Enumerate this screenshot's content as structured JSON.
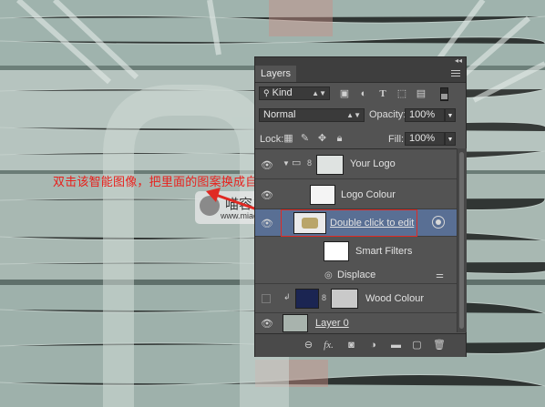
{
  "annotation": "双击该智能图像，把里面的图案换成自己的图案，保存后关闭。",
  "watermark": {
    "name": "喵容",
    "url": "www.miaorong.com"
  },
  "panel": {
    "tab_label": "Layers",
    "filter_kind": "Kind",
    "blend_mode": "Normal",
    "opacity_label": "Opacity:",
    "opacity_value": "100%",
    "lock_label": "Lock:",
    "fill_label": "Fill:",
    "fill_value": "100%",
    "filter_icons": [
      "image-icon",
      "adjustment-icon",
      "text-icon",
      "shape-icon",
      "smart-object-icon"
    ],
    "lock_icons": [
      "lock-pixels-icon",
      "lock-paint-icon",
      "lock-position-icon",
      "lock-all-icon"
    ],
    "layers": [
      {
        "name": "Your Logo",
        "type": "group"
      },
      {
        "name": "Logo Colour",
        "type": "layer"
      },
      {
        "name": "Double click to edit",
        "type": "smart-object",
        "selected": true
      },
      {
        "name": "Smart Filters",
        "type": "smart-filters"
      },
      {
        "name": "Displace",
        "type": "filter"
      },
      {
        "name": "Wood Colour",
        "type": "layer"
      },
      {
        "name": "Layer 0",
        "type": "layer"
      }
    ],
    "footer_icons": [
      "link-icon",
      "fx-icon",
      "mask-icon",
      "adjustment-layer-icon",
      "folder-icon",
      "new-layer-icon",
      "trash-icon"
    ],
    "footer_fx_text": "fx."
  },
  "colors": {
    "panel": "#535353",
    "selected": "#596f94",
    "annotation": "#e8201c"
  }
}
